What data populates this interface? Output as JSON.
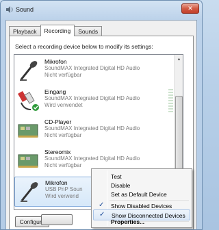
{
  "window": {
    "title": "Sound",
    "close_label": "✕"
  },
  "tabs": [
    {
      "label": "Playback"
    },
    {
      "label": "Recording"
    },
    {
      "label": "Sounds"
    }
  ],
  "instruction": "Select a recording device below to modify its settings:",
  "devices": [
    {
      "name": "Mikrofon",
      "driver": "SoundMAX Integrated Digital HD Audio",
      "status": "Nicht verfügbar",
      "icon": "microphone-icon"
    },
    {
      "name": "Eingang",
      "driver": "SoundMAX Integrated Digital HD Audio",
      "status": "Wird verwendet",
      "icon": "audio-cable-icon"
    },
    {
      "name": "CD-Player",
      "driver": "SoundMAX Integrated Digital HD Audio",
      "status": "Nicht verfügbar",
      "icon": "sound-card-icon"
    },
    {
      "name": "Stereomix",
      "driver": "SoundMAX Integrated Digital HD Audio",
      "status": "Nicht verfügbar",
      "icon": "sound-card-icon"
    },
    {
      "name": "Mikrofon",
      "driver": "USB PnP Soun",
      "status": "Wird verwend",
      "icon": "microphone-icon"
    }
  ],
  "buttons": {
    "configure": "Configure"
  },
  "context_menu": {
    "items": [
      {
        "label": "Test",
        "checked": false
      },
      {
        "label": "Disable",
        "checked": false
      },
      {
        "label": "Set as Default Device",
        "checked": false
      },
      {
        "label": "Show Disabled Devices",
        "checked": true
      },
      {
        "label": "Show Disconnected Devices",
        "checked": true
      },
      {
        "label": "Properties...",
        "checked": false
      }
    ],
    "check_glyph": "✓"
  }
}
